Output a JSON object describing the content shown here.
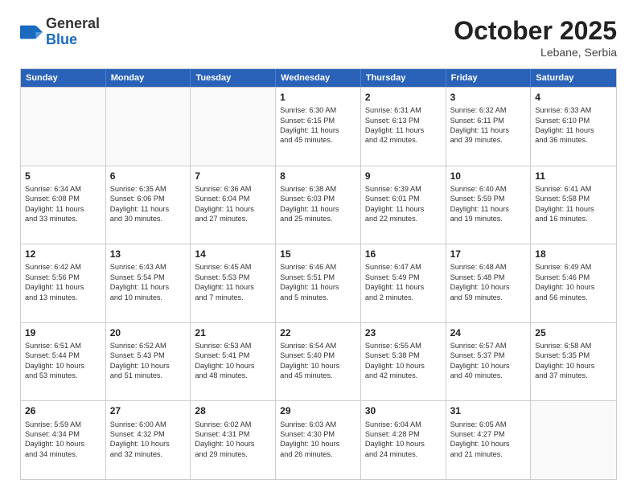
{
  "header": {
    "logo_general": "General",
    "logo_blue": "Blue",
    "month": "October 2025",
    "location": "Lebane, Serbia"
  },
  "weekdays": [
    "Sunday",
    "Monday",
    "Tuesday",
    "Wednesday",
    "Thursday",
    "Friday",
    "Saturday"
  ],
  "weeks": [
    [
      {
        "day": "",
        "info": ""
      },
      {
        "day": "",
        "info": ""
      },
      {
        "day": "",
        "info": ""
      },
      {
        "day": "1",
        "info": "Sunrise: 6:30 AM\nSunset: 6:15 PM\nDaylight: 11 hours\nand 45 minutes."
      },
      {
        "day": "2",
        "info": "Sunrise: 6:31 AM\nSunset: 6:13 PM\nDaylight: 11 hours\nand 42 minutes."
      },
      {
        "day": "3",
        "info": "Sunrise: 6:32 AM\nSunset: 6:11 PM\nDaylight: 11 hours\nand 39 minutes."
      },
      {
        "day": "4",
        "info": "Sunrise: 6:33 AM\nSunset: 6:10 PM\nDaylight: 11 hours\nand 36 minutes."
      }
    ],
    [
      {
        "day": "5",
        "info": "Sunrise: 6:34 AM\nSunset: 6:08 PM\nDaylight: 11 hours\nand 33 minutes."
      },
      {
        "day": "6",
        "info": "Sunrise: 6:35 AM\nSunset: 6:06 PM\nDaylight: 11 hours\nand 30 minutes."
      },
      {
        "day": "7",
        "info": "Sunrise: 6:36 AM\nSunset: 6:04 PM\nDaylight: 11 hours\nand 27 minutes."
      },
      {
        "day": "8",
        "info": "Sunrise: 6:38 AM\nSunset: 6:03 PM\nDaylight: 11 hours\nand 25 minutes."
      },
      {
        "day": "9",
        "info": "Sunrise: 6:39 AM\nSunset: 6:01 PM\nDaylight: 11 hours\nand 22 minutes."
      },
      {
        "day": "10",
        "info": "Sunrise: 6:40 AM\nSunset: 5:59 PM\nDaylight: 11 hours\nand 19 minutes."
      },
      {
        "day": "11",
        "info": "Sunrise: 6:41 AM\nSunset: 5:58 PM\nDaylight: 11 hours\nand 16 minutes."
      }
    ],
    [
      {
        "day": "12",
        "info": "Sunrise: 6:42 AM\nSunset: 5:56 PM\nDaylight: 11 hours\nand 13 minutes."
      },
      {
        "day": "13",
        "info": "Sunrise: 6:43 AM\nSunset: 5:54 PM\nDaylight: 11 hours\nand 10 minutes."
      },
      {
        "day": "14",
        "info": "Sunrise: 6:45 AM\nSunset: 5:53 PM\nDaylight: 11 hours\nand 7 minutes."
      },
      {
        "day": "15",
        "info": "Sunrise: 6:46 AM\nSunset: 5:51 PM\nDaylight: 11 hours\nand 5 minutes."
      },
      {
        "day": "16",
        "info": "Sunrise: 6:47 AM\nSunset: 5:49 PM\nDaylight: 11 hours\nand 2 minutes."
      },
      {
        "day": "17",
        "info": "Sunrise: 6:48 AM\nSunset: 5:48 PM\nDaylight: 10 hours\nand 59 minutes."
      },
      {
        "day": "18",
        "info": "Sunrise: 6:49 AM\nSunset: 5:46 PM\nDaylight: 10 hours\nand 56 minutes."
      }
    ],
    [
      {
        "day": "19",
        "info": "Sunrise: 6:51 AM\nSunset: 5:44 PM\nDaylight: 10 hours\nand 53 minutes."
      },
      {
        "day": "20",
        "info": "Sunrise: 6:52 AM\nSunset: 5:43 PM\nDaylight: 10 hours\nand 51 minutes."
      },
      {
        "day": "21",
        "info": "Sunrise: 6:53 AM\nSunset: 5:41 PM\nDaylight: 10 hours\nand 48 minutes."
      },
      {
        "day": "22",
        "info": "Sunrise: 6:54 AM\nSunset: 5:40 PM\nDaylight: 10 hours\nand 45 minutes."
      },
      {
        "day": "23",
        "info": "Sunrise: 6:55 AM\nSunset: 5:38 PM\nDaylight: 10 hours\nand 42 minutes."
      },
      {
        "day": "24",
        "info": "Sunrise: 6:57 AM\nSunset: 5:37 PM\nDaylight: 10 hours\nand 40 minutes."
      },
      {
        "day": "25",
        "info": "Sunrise: 6:58 AM\nSunset: 5:35 PM\nDaylight: 10 hours\nand 37 minutes."
      }
    ],
    [
      {
        "day": "26",
        "info": "Sunrise: 5:59 AM\nSunset: 4:34 PM\nDaylight: 10 hours\nand 34 minutes."
      },
      {
        "day": "27",
        "info": "Sunrise: 6:00 AM\nSunset: 4:32 PM\nDaylight: 10 hours\nand 32 minutes."
      },
      {
        "day": "28",
        "info": "Sunrise: 6:02 AM\nSunset: 4:31 PM\nDaylight: 10 hours\nand 29 minutes."
      },
      {
        "day": "29",
        "info": "Sunrise: 6:03 AM\nSunset: 4:30 PM\nDaylight: 10 hours\nand 26 minutes."
      },
      {
        "day": "30",
        "info": "Sunrise: 6:04 AM\nSunset: 4:28 PM\nDaylight: 10 hours\nand 24 minutes."
      },
      {
        "day": "31",
        "info": "Sunrise: 6:05 AM\nSunset: 4:27 PM\nDaylight: 10 hours\nand 21 minutes."
      },
      {
        "day": "",
        "info": ""
      }
    ]
  ]
}
